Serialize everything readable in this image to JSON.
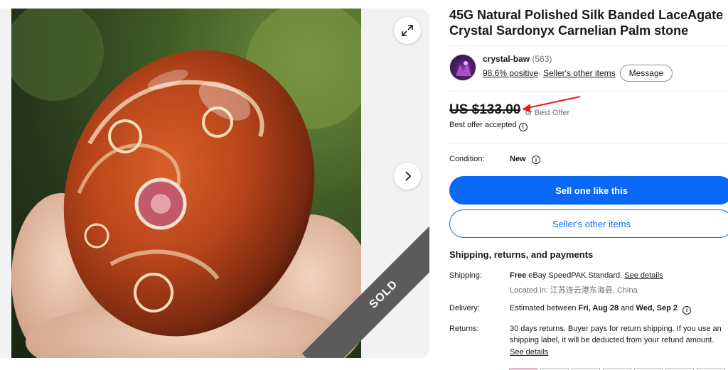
{
  "gallery": {
    "expand_icon": "expand-icon",
    "next_icon": "chevron-right-icon",
    "ribbon_text": "SOLD"
  },
  "listing": {
    "title": "45G Natural Polished Silk Banded LaceAgate Crystal Sardonyx Carnelian Palm stone"
  },
  "seller": {
    "name": "crystal-baw",
    "feedback_count": "(563)",
    "positive": "98.6% positive",
    "separator": "·",
    "other_items_link": "Seller's other items",
    "message_button": "Message"
  },
  "price": {
    "amount": "US $133.00",
    "or_best_offer": "or Best Offer",
    "best_offer_accepted": "Best offer accepted"
  },
  "condition": {
    "label": "Condition:",
    "value": "New"
  },
  "actions": {
    "primary": "Sell one like this",
    "secondary": "Seller's other items"
  },
  "shipping": {
    "heading": "Shipping, returns, and payments",
    "shipping_label": "Shipping:",
    "shipping_free": "Free",
    "shipping_method": " eBay SpeedPAK Standard. ",
    "see_details": "See details",
    "located_label": "Located in: ",
    "located_value": "江苏连云港东海县, China",
    "delivery_label": "Delivery:",
    "delivery_prefix": "Estimated between ",
    "delivery_from": "Fri, Aug 28",
    "delivery_and": " and ",
    "delivery_to": "Wed, Sep 2",
    "returns_label": "Returns:",
    "returns_line1": "30 days returns. Buyer pays for return shipping. If you use an",
    "returns_line2": "shipping label, it will be deducted from your refund amount.",
    "returns_see_details": "See details"
  },
  "colors": {
    "primary_blue": "#0968f6",
    "annotation_red": "#e02020",
    "ribbon_gray": "#5b5b5b"
  }
}
